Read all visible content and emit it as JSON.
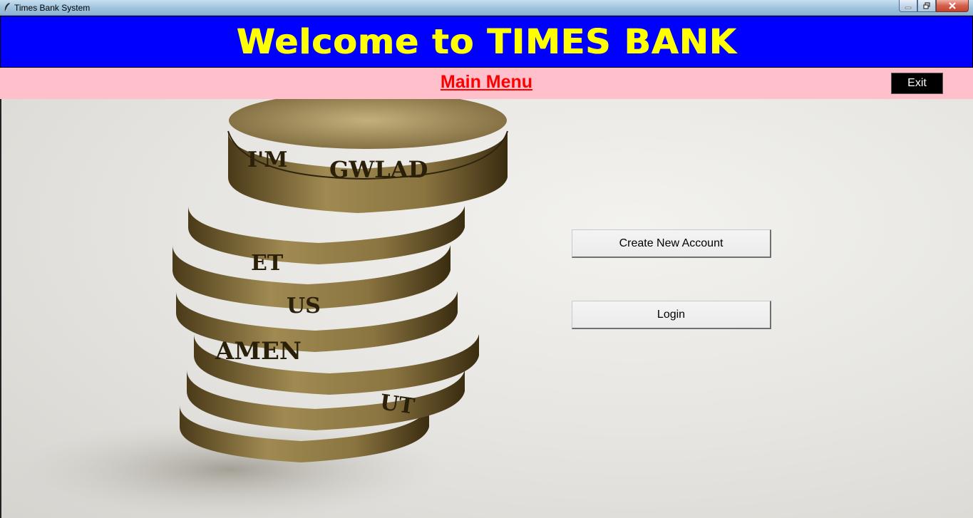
{
  "window": {
    "title": "Times Bank System",
    "controls": {
      "minimize_icon": "minimize-icon",
      "maximize_icon": "restore-icon",
      "close_icon": "close-icon"
    }
  },
  "header": {
    "title": "Welcome to TIMES BANK",
    "background_color": "#0000ff",
    "text_color": "#ffff00"
  },
  "menubar": {
    "title": "Main Menu",
    "exit_label": "Exit",
    "background_color": "#ffc0cb",
    "title_color": "#ff0000"
  },
  "main": {
    "background_image": "stack of coins",
    "coin_text": [
      "I'M",
      "GWLAD",
      "UT",
      "AMEN",
      "US",
      "ET"
    ],
    "buttons": {
      "create_account": "Create New Account",
      "login": "Login"
    }
  }
}
